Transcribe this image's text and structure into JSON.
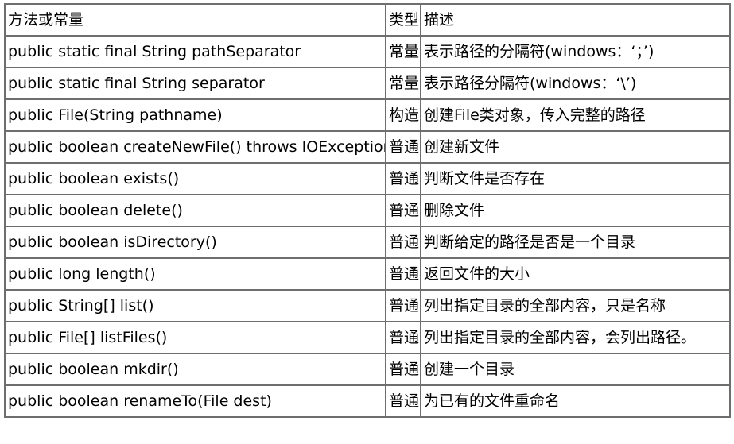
{
  "table": {
    "headers": {
      "method": "方法或常量",
      "type": "类型",
      "desc": "描述"
    },
    "rows": [
      {
        "method": "public static final String pathSeparator",
        "type": "常量",
        "desc": "表示路径的分隔符(windows：‘；’)"
      },
      {
        "method": "public static final String separator",
        "type": "常量",
        "desc": "表示路径分隔符(windows：‘\\’)"
      },
      {
        "method": "public File(String pathname)",
        "type": "构造",
        "desc": "创建File类对象，传入完整的路径"
      },
      {
        "method": "public boolean createNewFile() throws IOException",
        "type": "普通",
        "desc": "创建新文件"
      },
      {
        "method": "public boolean exists()",
        "type": "普通",
        "desc": "判断文件是否存在"
      },
      {
        "method": "public boolean delete()",
        "type": "普通",
        "desc": "删除文件"
      },
      {
        "method": "public boolean isDirectory()",
        "type": "普通",
        "desc": "判断给定的路径是否是一个目录"
      },
      {
        "method": "public long length()",
        "type": "普通",
        "desc": "返回文件的大小"
      },
      {
        "method": "public String[] list()",
        "type": "普通",
        "desc": "列出指定目录的全部内容，只是名称"
      },
      {
        "method": "public File[] listFiles()",
        "type": "普通",
        "desc": "列出指定目录的全部内容，会列出路径。"
      },
      {
        "method": "public boolean mkdir()",
        "type": "普通",
        "desc": "创建一个目录"
      },
      {
        "method": "public boolean renameTo(File dest)",
        "type": "普通",
        "desc": "为已有的文件重命名"
      }
    ]
  }
}
